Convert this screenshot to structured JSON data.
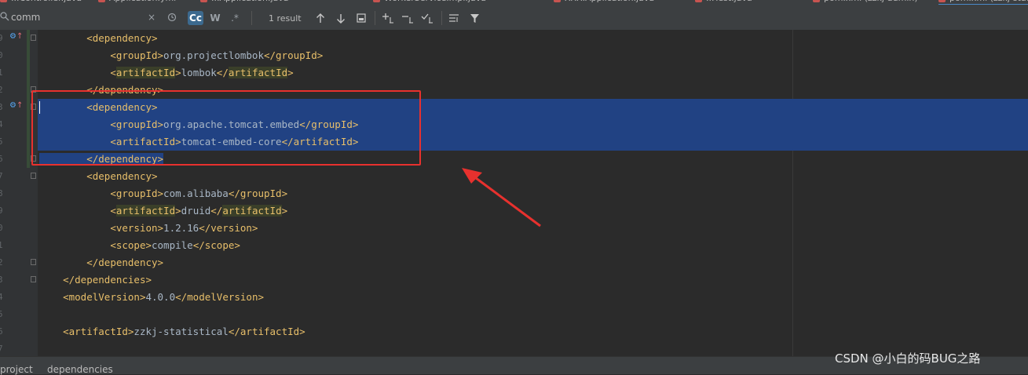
{
  "tabs": [
    {
      "label": "...Controller.java"
    },
    {
      "label": "Application.yml"
    },
    {
      "label": "...Application.java"
    },
    {
      "label": "WorkerServiceImpl.java"
    },
    {
      "label": "XXX.Application.java"
    },
    {
      "label": "...Test.java"
    },
    {
      "label": "pom.xml (zzkj-admin)"
    },
    {
      "label": "pom.xml (zzkj-statistical)"
    }
  ],
  "search": {
    "query": "comm",
    "case_label": "Cc",
    "words_label": "W",
    "regex_label": ".*",
    "results": "1 result",
    "clear_icon": "×"
  },
  "gutter": {
    "line_numbers": [
      "9",
      "0",
      "1",
      "2",
      "3",
      "4",
      "5",
      "6",
      "7",
      "8",
      "9",
      "0",
      "1",
      "2",
      "3",
      "4",
      "5",
      "6",
      "7"
    ]
  },
  "code": {
    "lines": [
      [
        {
          "t": "        "
        },
        {
          "t": "<dependency>",
          "c": "#e8bf6a"
        }
      ],
      [
        {
          "t": "            "
        },
        {
          "t": "<groupId>",
          "c": "#e8bf6a"
        },
        {
          "t": "org.projectlombok"
        },
        {
          "t": "</groupId>",
          "c": "#e8bf6a"
        }
      ],
      [
        {
          "t": "            "
        },
        {
          "t": "<",
          "c": "#e8bf6a"
        },
        {
          "t": "artifactId",
          "c": "#e8bf6a",
          "h": true
        },
        {
          "t": ">",
          "c": "#e8bf6a"
        },
        {
          "t": "lombok"
        },
        {
          "t": "</",
          "c": "#e8bf6a"
        },
        {
          "t": "artifactId",
          "c": "#e8bf6a",
          "h": true
        },
        {
          "t": ">",
          "c": "#e8bf6a"
        }
      ],
      [
        {
          "t": "        "
        },
        {
          "t": "</dependency>",
          "c": "#e8bf6a"
        }
      ],
      [
        {
          "t": "        "
        },
        {
          "t": "<dependency>",
          "c": "#e8bf6a"
        }
      ],
      [
        {
          "t": "            "
        },
        {
          "t": "<groupId>",
          "c": "#e8bf6a"
        },
        {
          "t": "org.apache.tomcat.embed"
        },
        {
          "t": "</groupId>",
          "c": "#e8bf6a"
        }
      ],
      [
        {
          "t": "            "
        },
        {
          "t": "<artifactId>",
          "c": "#e8bf6a"
        },
        {
          "t": "tomcat-embed-core"
        },
        {
          "t": "</artifactId>",
          "c": "#e8bf6a"
        }
      ],
      [
        {
          "t": "        "
        },
        {
          "t": "</dependency>",
          "c": "#e8bf6a"
        }
      ],
      [
        {
          "t": "        "
        },
        {
          "t": "<dependency>",
          "c": "#e8bf6a"
        }
      ],
      [
        {
          "t": "            "
        },
        {
          "t": "<groupId>",
          "c": "#e8bf6a"
        },
        {
          "t": "com.alibaba"
        },
        {
          "t": "</groupId>",
          "c": "#e8bf6a"
        }
      ],
      [
        {
          "t": "            "
        },
        {
          "t": "<",
          "c": "#e8bf6a"
        },
        {
          "t": "artifactId",
          "c": "#e8bf6a",
          "h": true
        },
        {
          "t": ">",
          "c": "#e8bf6a"
        },
        {
          "t": "druid"
        },
        {
          "t": "</",
          "c": "#e8bf6a"
        },
        {
          "t": "artifactId",
          "c": "#e8bf6a",
          "h": true
        },
        {
          "t": ">",
          "c": "#e8bf6a"
        }
      ],
      [
        {
          "t": "            "
        },
        {
          "t": "<version>",
          "c": "#e8bf6a"
        },
        {
          "t": "1.2.16"
        },
        {
          "t": "</version>",
          "c": "#e8bf6a"
        }
      ],
      [
        {
          "t": "            "
        },
        {
          "t": "<scope>",
          "c": "#e8bf6a"
        },
        {
          "t": "compile"
        },
        {
          "t": "</scope>",
          "c": "#e8bf6a"
        }
      ],
      [
        {
          "t": "        "
        },
        {
          "t": "</dependency>",
          "c": "#e8bf6a"
        }
      ],
      [
        {
          "t": "    "
        },
        {
          "t": "</dependencies>",
          "c": "#e8bf6a"
        }
      ],
      [
        {
          "t": "    "
        },
        {
          "t": "<modelVersion>",
          "c": "#e8bf6a"
        },
        {
          "t": "4.0.0"
        },
        {
          "t": "</modelVersion>",
          "c": "#e8bf6a"
        }
      ],
      [],
      [
        {
          "t": "    "
        },
        {
          "t": "<artifactId>",
          "c": "#e8bf6a"
        },
        {
          "t": "zzkj-statistical"
        },
        {
          "t": "</artifactId>",
          "c": "#e8bf6a"
        }
      ],
      []
    ]
  },
  "breadcrumb": [
    "project",
    "dependencies"
  ],
  "watermark": "CSDN @小白的码BUG之路",
  "colors": {
    "selection": "#214283",
    "annotation": "#e8312e",
    "tag": "#e8bf6a",
    "text": "#a9b7c6"
  }
}
